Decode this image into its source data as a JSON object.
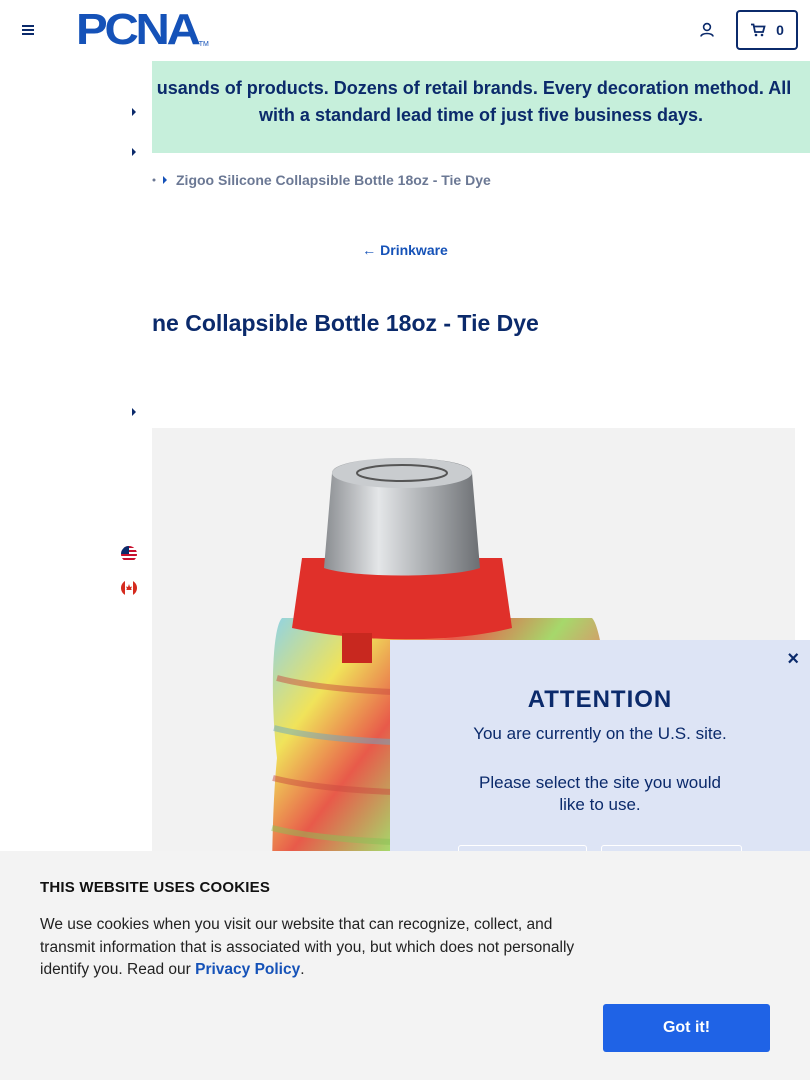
{
  "header": {
    "logo_text": "PCNA",
    "logo_tm": "TM",
    "cart_count": "0"
  },
  "banner": {
    "line1": "usands of products. Dozens of retail brands. Every decoration method. All",
    "line2": "with a standard lead time of just five business days."
  },
  "breadcrumb": {
    "current": "Zigoo Silicone Collapsible Bottle 18oz - Tie Dye"
  },
  "back_link": {
    "label": "Drinkware"
  },
  "product": {
    "title": "ne Collapsible Bottle 18oz - Tie Dye"
  },
  "attention_modal": {
    "close": "×",
    "title": "ATTENTION",
    "current_site": "You are currently on the U.S. site.",
    "select_prompt": "Please select the site you would like to use."
  },
  "cookie_banner": {
    "title": "THIS WEBSITE USES COOKIES",
    "body": "We use cookies when you visit our website that can recognize, collect, and transmit information that is associated with you, but which does not personally identify you. Read our",
    "link": "Privacy Policy",
    "period": ".",
    "button": "Got it!"
  },
  "colors": {
    "brand_navy": "#0b2a6b",
    "brand_blue": "#1552b8",
    "banner_green": "#c6efdb",
    "modal_bg": "#dde4f5",
    "cookie_bg": "#f3f3f3",
    "button_blue": "#1f63e6"
  },
  "icons": [
    "menu-icon",
    "account-icon",
    "cart-icon",
    "chevron-right-icon",
    "us-flag-icon",
    "canada-flag-icon",
    "arrow-left-icon",
    "close-icon"
  ]
}
